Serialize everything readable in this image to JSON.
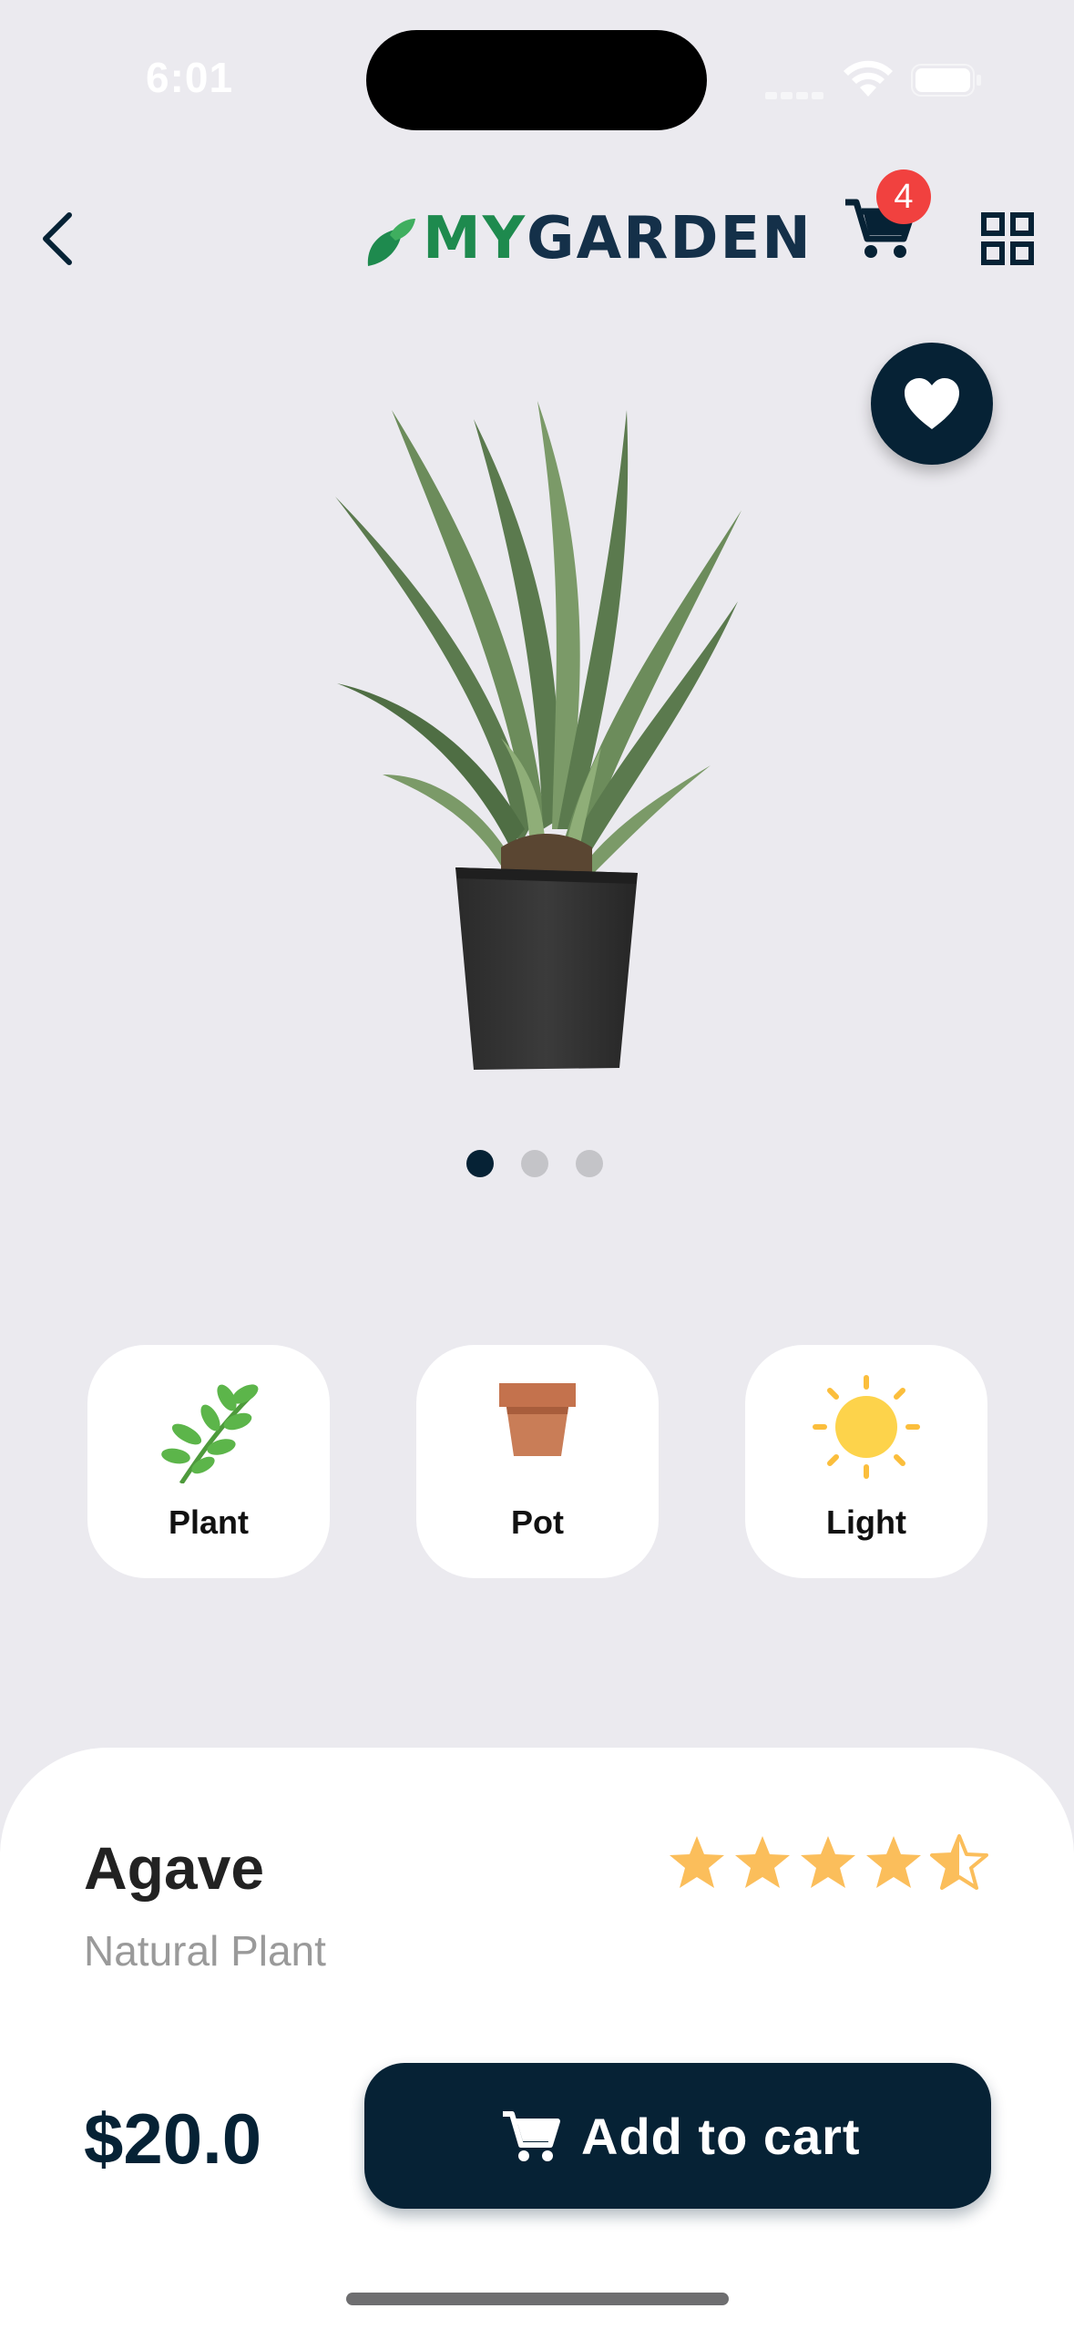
{
  "status_bar": {
    "time": "6:01"
  },
  "header": {
    "logo_prefix": "MY",
    "logo_suffix": "GARDEN",
    "cart_count": "4"
  },
  "carousel": {
    "total": 3,
    "active": 0
  },
  "features": [
    {
      "label": "Plant",
      "icon": "plant-sprig-icon"
    },
    {
      "label": "Pot",
      "icon": "flower-pot-icon"
    },
    {
      "label": "Light",
      "icon": "sun-icon"
    }
  ],
  "product": {
    "name": "Agave",
    "type": "Natural Plant",
    "rating": 4.5,
    "rating_max": 5,
    "price": "$20.0"
  },
  "actions": {
    "add_to_cart": "Add to cart"
  },
  "colors": {
    "primary": "#062235",
    "background": "#EBEAEF",
    "badge": "#F1413F",
    "star": "#FBBE5B",
    "logo_green": "#1E8A4E"
  }
}
